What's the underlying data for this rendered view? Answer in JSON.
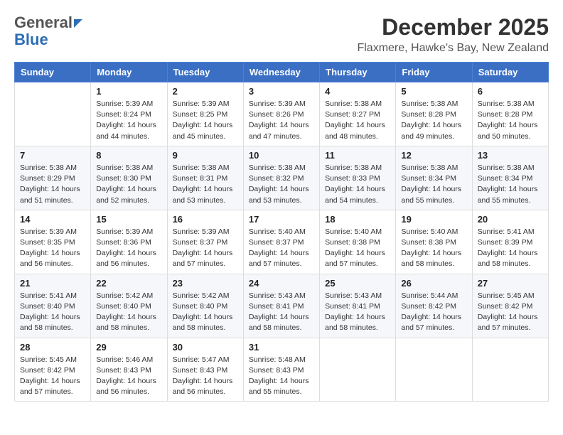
{
  "header": {
    "logo_general": "General",
    "logo_blue": "Blue",
    "month": "December 2025",
    "location": "Flaxmere, Hawke's Bay, New Zealand"
  },
  "days_of_week": [
    "Sunday",
    "Monday",
    "Tuesday",
    "Wednesday",
    "Thursday",
    "Friday",
    "Saturday"
  ],
  "weeks": [
    [
      {
        "day": "",
        "info": ""
      },
      {
        "day": "1",
        "info": "Sunrise: 5:39 AM\nSunset: 8:24 PM\nDaylight: 14 hours\nand 44 minutes."
      },
      {
        "day": "2",
        "info": "Sunrise: 5:39 AM\nSunset: 8:25 PM\nDaylight: 14 hours\nand 45 minutes."
      },
      {
        "day": "3",
        "info": "Sunrise: 5:39 AM\nSunset: 8:26 PM\nDaylight: 14 hours\nand 47 minutes."
      },
      {
        "day": "4",
        "info": "Sunrise: 5:38 AM\nSunset: 8:27 PM\nDaylight: 14 hours\nand 48 minutes."
      },
      {
        "day": "5",
        "info": "Sunrise: 5:38 AM\nSunset: 8:28 PM\nDaylight: 14 hours\nand 49 minutes."
      },
      {
        "day": "6",
        "info": "Sunrise: 5:38 AM\nSunset: 8:28 PM\nDaylight: 14 hours\nand 50 minutes."
      }
    ],
    [
      {
        "day": "7",
        "info": "Sunrise: 5:38 AM\nSunset: 8:29 PM\nDaylight: 14 hours\nand 51 minutes."
      },
      {
        "day": "8",
        "info": "Sunrise: 5:38 AM\nSunset: 8:30 PM\nDaylight: 14 hours\nand 52 minutes."
      },
      {
        "day": "9",
        "info": "Sunrise: 5:38 AM\nSunset: 8:31 PM\nDaylight: 14 hours\nand 53 minutes."
      },
      {
        "day": "10",
        "info": "Sunrise: 5:38 AM\nSunset: 8:32 PM\nDaylight: 14 hours\nand 53 minutes."
      },
      {
        "day": "11",
        "info": "Sunrise: 5:38 AM\nSunset: 8:33 PM\nDaylight: 14 hours\nand 54 minutes."
      },
      {
        "day": "12",
        "info": "Sunrise: 5:38 AM\nSunset: 8:34 PM\nDaylight: 14 hours\nand 55 minutes."
      },
      {
        "day": "13",
        "info": "Sunrise: 5:38 AM\nSunset: 8:34 PM\nDaylight: 14 hours\nand 55 minutes."
      }
    ],
    [
      {
        "day": "14",
        "info": "Sunrise: 5:39 AM\nSunset: 8:35 PM\nDaylight: 14 hours\nand 56 minutes."
      },
      {
        "day": "15",
        "info": "Sunrise: 5:39 AM\nSunset: 8:36 PM\nDaylight: 14 hours\nand 56 minutes."
      },
      {
        "day": "16",
        "info": "Sunrise: 5:39 AM\nSunset: 8:37 PM\nDaylight: 14 hours\nand 57 minutes."
      },
      {
        "day": "17",
        "info": "Sunrise: 5:40 AM\nSunset: 8:37 PM\nDaylight: 14 hours\nand 57 minutes."
      },
      {
        "day": "18",
        "info": "Sunrise: 5:40 AM\nSunset: 8:38 PM\nDaylight: 14 hours\nand 57 minutes."
      },
      {
        "day": "19",
        "info": "Sunrise: 5:40 AM\nSunset: 8:38 PM\nDaylight: 14 hours\nand 58 minutes."
      },
      {
        "day": "20",
        "info": "Sunrise: 5:41 AM\nSunset: 8:39 PM\nDaylight: 14 hours\nand 58 minutes."
      }
    ],
    [
      {
        "day": "21",
        "info": "Sunrise: 5:41 AM\nSunset: 8:40 PM\nDaylight: 14 hours\nand 58 minutes."
      },
      {
        "day": "22",
        "info": "Sunrise: 5:42 AM\nSunset: 8:40 PM\nDaylight: 14 hours\nand 58 minutes."
      },
      {
        "day": "23",
        "info": "Sunrise: 5:42 AM\nSunset: 8:40 PM\nDaylight: 14 hours\nand 58 minutes."
      },
      {
        "day": "24",
        "info": "Sunrise: 5:43 AM\nSunset: 8:41 PM\nDaylight: 14 hours\nand 58 minutes."
      },
      {
        "day": "25",
        "info": "Sunrise: 5:43 AM\nSunset: 8:41 PM\nDaylight: 14 hours\nand 58 minutes."
      },
      {
        "day": "26",
        "info": "Sunrise: 5:44 AM\nSunset: 8:42 PM\nDaylight: 14 hours\nand 57 minutes."
      },
      {
        "day": "27",
        "info": "Sunrise: 5:45 AM\nSunset: 8:42 PM\nDaylight: 14 hours\nand 57 minutes."
      }
    ],
    [
      {
        "day": "28",
        "info": "Sunrise: 5:45 AM\nSunset: 8:42 PM\nDaylight: 14 hours\nand 57 minutes."
      },
      {
        "day": "29",
        "info": "Sunrise: 5:46 AM\nSunset: 8:43 PM\nDaylight: 14 hours\nand 56 minutes."
      },
      {
        "day": "30",
        "info": "Sunrise: 5:47 AM\nSunset: 8:43 PM\nDaylight: 14 hours\nand 56 minutes."
      },
      {
        "day": "31",
        "info": "Sunrise: 5:48 AM\nSunset: 8:43 PM\nDaylight: 14 hours\nand 55 minutes."
      },
      {
        "day": "",
        "info": ""
      },
      {
        "day": "",
        "info": ""
      },
      {
        "day": "",
        "info": ""
      }
    ]
  ]
}
